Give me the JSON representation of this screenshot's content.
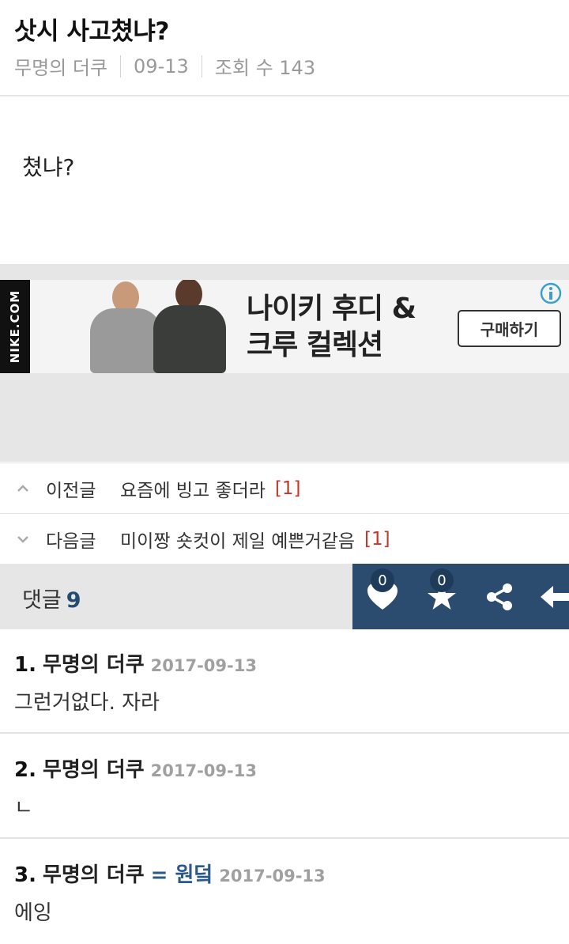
{
  "post": {
    "title": "삿시 사고쳤냐?",
    "author": "무명의 더쿠",
    "date": "09-13",
    "views_label": "조회 수 143",
    "body": "쳤냐?"
  },
  "ad": {
    "brand_text": "NIKE.COM",
    "headline_line1": "나이키 후디 &",
    "headline_line2": "크루 컬렉션",
    "cta_label": "구매하기",
    "info_color": "#3aa0c8"
  },
  "nav": {
    "prev": {
      "label": "이전글",
      "title": "요즘에 빙고 좋더라",
      "count": "[1]"
    },
    "next": {
      "label": "다음글",
      "title": "미이짱 숏컷이 제일 예쁜거같음",
      "count": "[1]"
    }
  },
  "comments_bar": {
    "label": "댓글",
    "count": "9",
    "like_count": "0",
    "star_count": "0"
  },
  "comments": [
    {
      "num": "1.",
      "author": "무명의 더쿠",
      "op_tag": "",
      "date": "2017-09-13",
      "text": "그런거없다. 자라"
    },
    {
      "num": "2.",
      "author": "무명의 더쿠",
      "op_tag": "",
      "date": "2017-09-13",
      "text": "ㄴ"
    },
    {
      "num": "3.",
      "author": "무명의 더쿠",
      "op_tag": "= 원덬",
      "date": "2017-09-13",
      "text": "에잉"
    }
  ],
  "colors": {
    "accent": "#2b4c6f",
    "reply_count": "#c0392b",
    "op_tag": "#2b5a8a"
  }
}
